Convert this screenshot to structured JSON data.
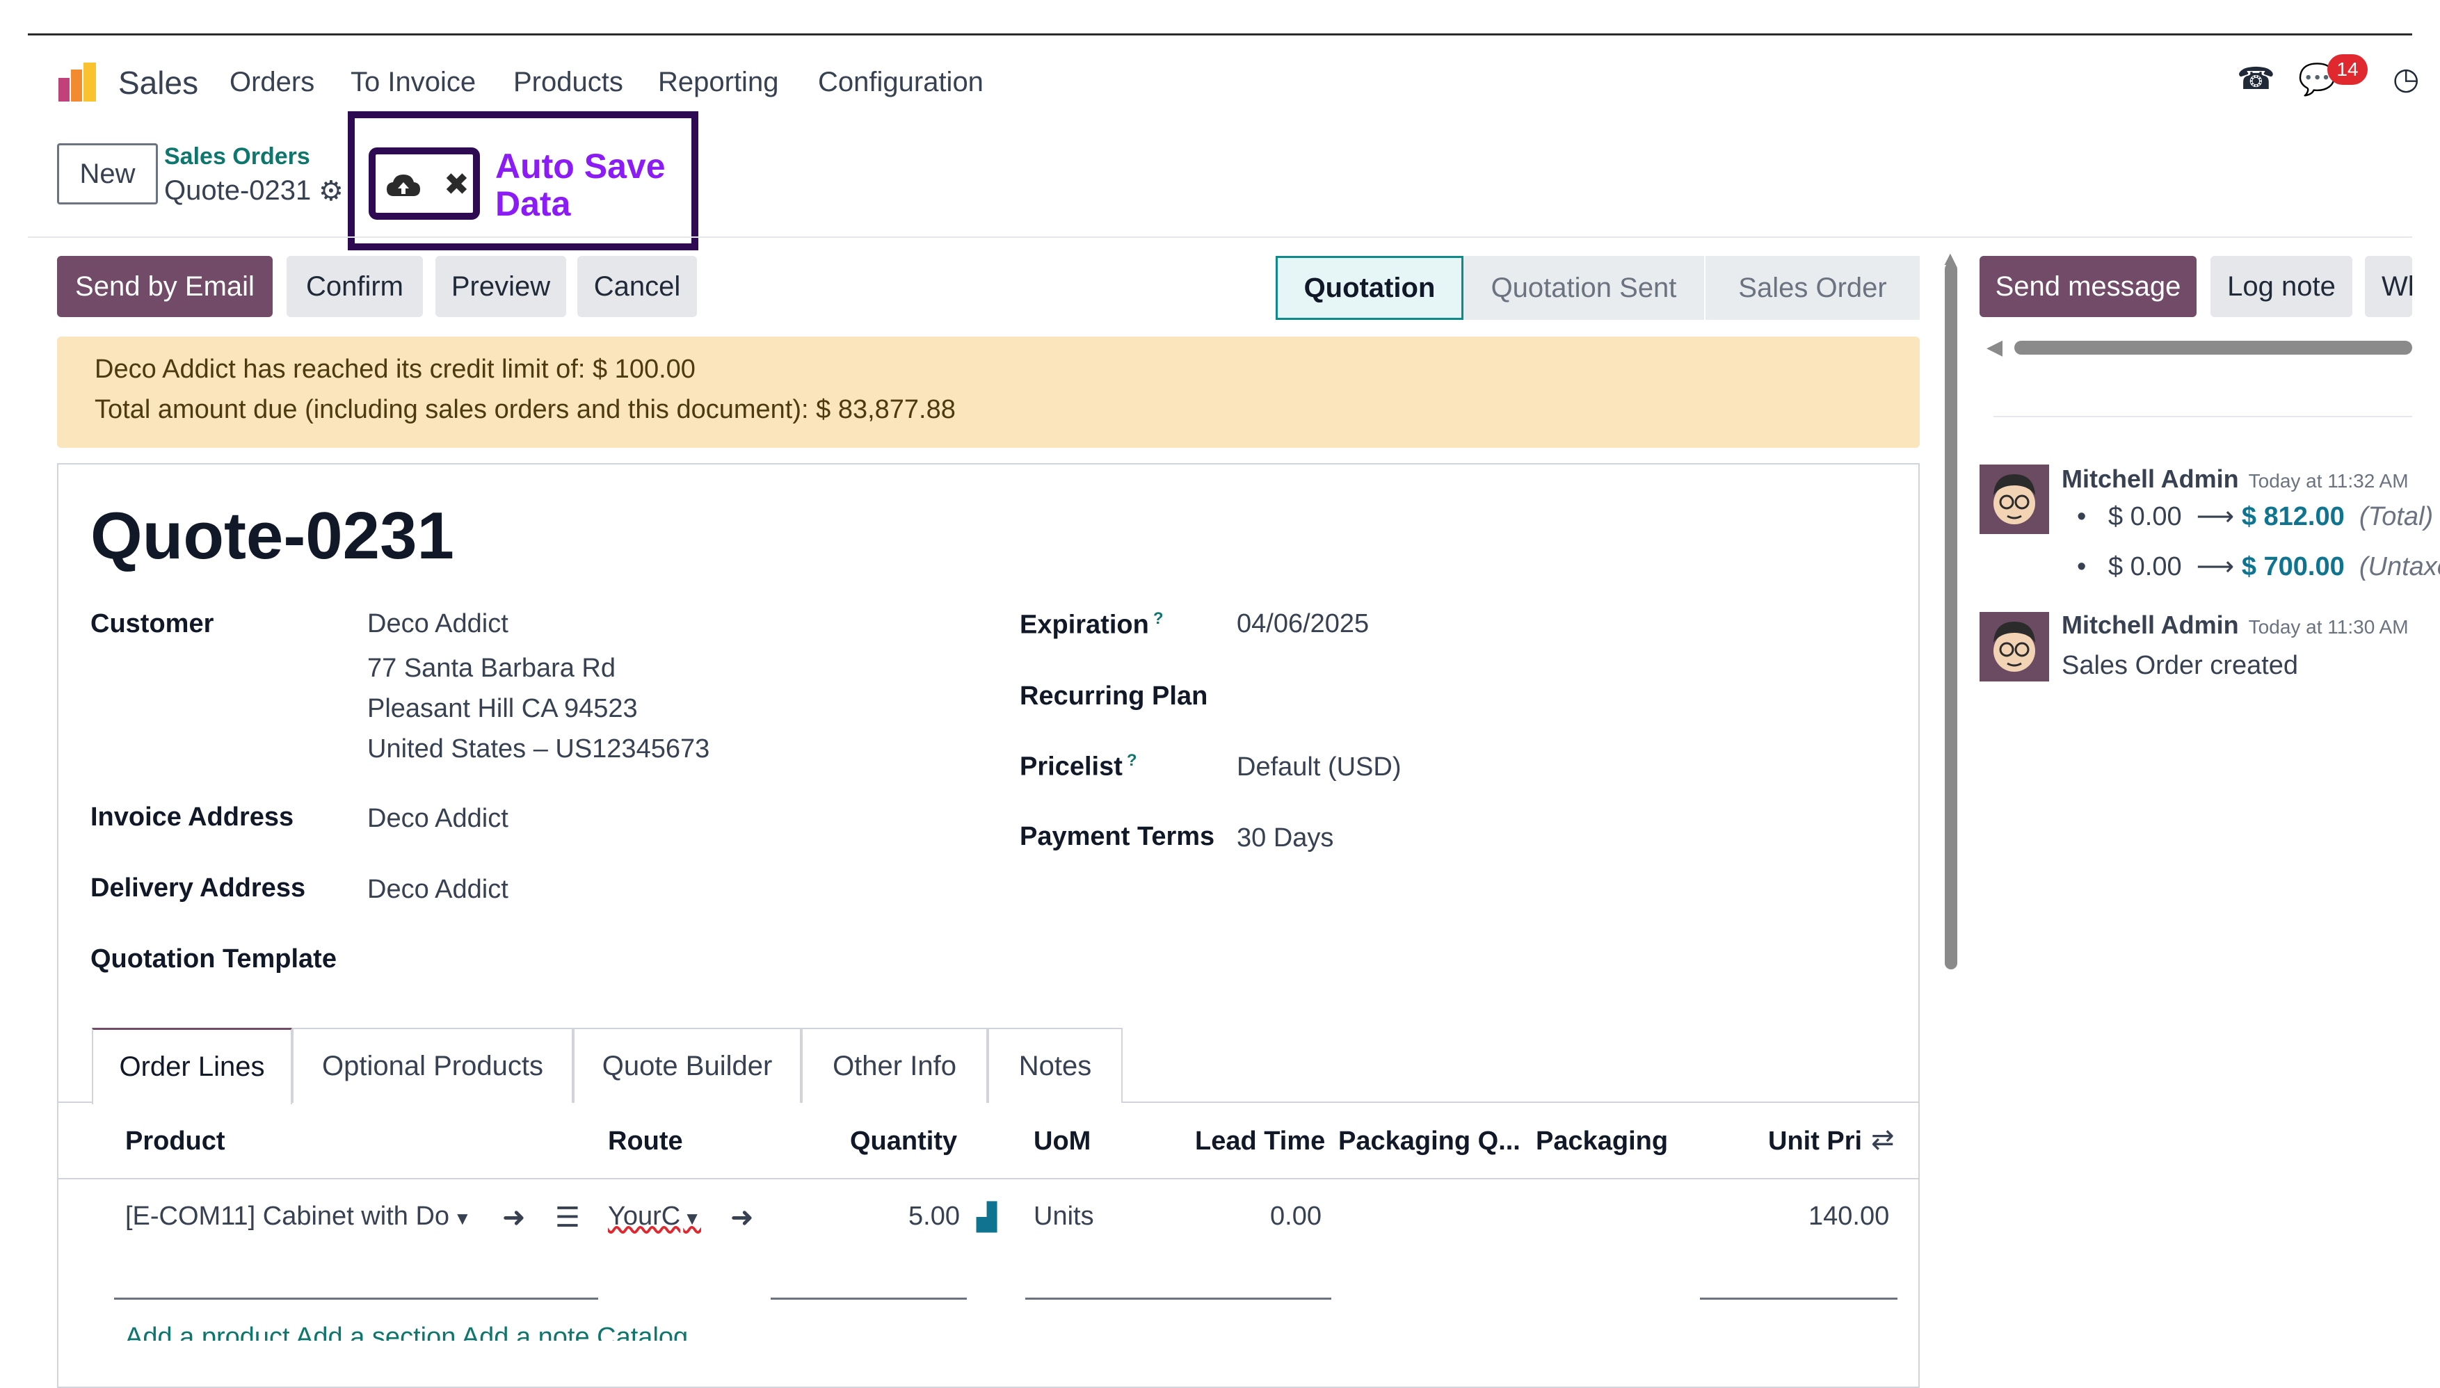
{
  "navbar": {
    "app_name": "Sales",
    "menu": [
      "Orders",
      "To Invoice",
      "Products",
      "Reporting",
      "Configuration"
    ],
    "notification_count": "14",
    "icons": [
      "phone-icon",
      "chat-icon",
      "clock-icon"
    ]
  },
  "control_panel": {
    "new_label": "New",
    "breadcrumb_parent": "Sales Orders",
    "breadcrumb_current": "Quote-0231",
    "autosave_annotation": "Auto Save Data"
  },
  "actions": {
    "send_by_email": "Send by Email",
    "confirm": "Confirm",
    "preview": "Preview",
    "cancel": "Cancel"
  },
  "statusbar": {
    "stages": [
      "Quotation",
      "Quotation Sent",
      "Sales Order"
    ],
    "active": "Quotation"
  },
  "alert": {
    "line1": "Deco Addict has reached its credit limit of: $ 100.00",
    "line2": "Total amount due (including sales orders and this document): $ 83,877.88"
  },
  "form": {
    "title": "Quote-0231",
    "customer_label": "Customer",
    "customer_name": "Deco Addict",
    "customer_street": "77 Santa Barbara Rd",
    "customer_city": "Pleasant Hill CA 94523",
    "customer_country": "United States – US12345673",
    "invoice_address_label": "Invoice Address",
    "invoice_address": "Deco Addict",
    "delivery_address_label": "Delivery Address",
    "delivery_address": "Deco Addict",
    "quotation_template_label": "Quotation Template",
    "expiration_label": "Expiration",
    "expiration": "04/06/2025",
    "recurring_plan_label": "Recurring Plan",
    "pricelist_label": "Pricelist",
    "pricelist": "Default (USD)",
    "payment_terms_label": "Payment Terms",
    "payment_terms": "30 Days",
    "help_mark": "?"
  },
  "tabs": [
    "Order Lines",
    "Optional Products",
    "Quote Builder",
    "Other Info",
    "Notes"
  ],
  "order_lines": {
    "headers": [
      "Product",
      "Route",
      "Quantity",
      "UoM",
      "Lead Time",
      "Packaging Q...",
      "Packaging",
      "Unit Pri"
    ],
    "rows": [
      {
        "product": "[E-COM11] Cabinet with Do",
        "route": "YourC",
        "quantity": "5.00",
        "uom": "Units",
        "lead_time": "0.00",
        "unit_price": "140.00"
      }
    ],
    "footer_links": "Add a product   Add a section   Add a note   Catalog"
  },
  "chatter": {
    "send_message": "Send message",
    "log_note": "Log note",
    "third_button": "Wh",
    "messages": [
      {
        "author": "Mitchell Admin",
        "time": "Today at 11:32 AM",
        "changes": [
          {
            "old": "$ 0.00",
            "new": "$ 812.00",
            "field": "(Total)"
          },
          {
            "old": "$ 0.00",
            "new": "$ 700.00",
            "field": "(Untaxed)"
          }
        ]
      },
      {
        "author": "Mitchell Admin",
        "time": "Today at 11:30 AM",
        "text": "Sales Order created"
      }
    ]
  },
  "colors": {
    "brand": "#714b67",
    "teal": "#0f766e",
    "alert_bg": "#fbe5bd",
    "annotation": "#8b1cf5"
  }
}
